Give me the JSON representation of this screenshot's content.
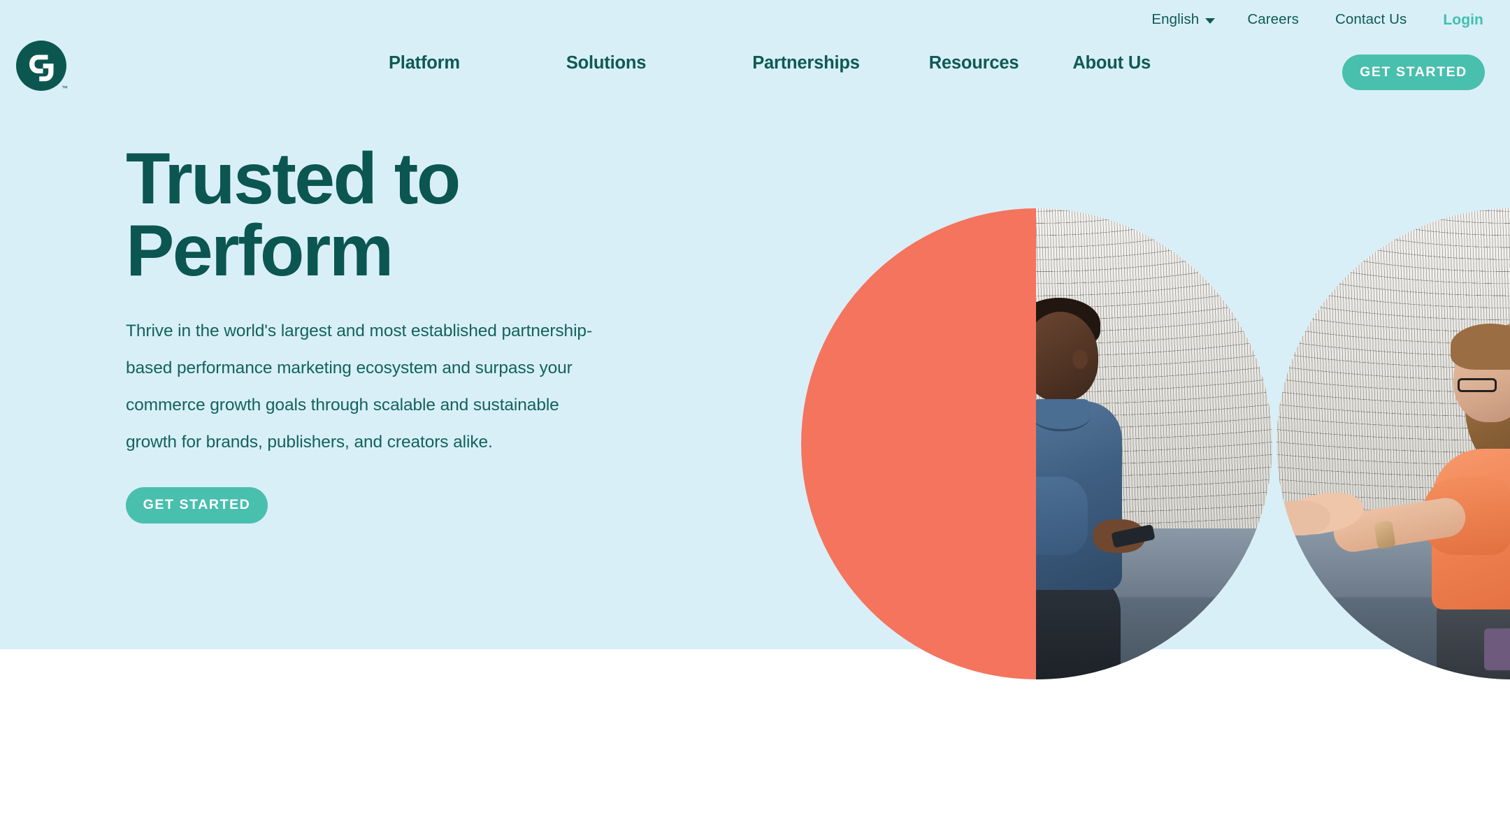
{
  "brand": {
    "logo_name": "cj-logo",
    "logo_tm": "™",
    "colors": {
      "hero_background": "#d9eff8",
      "dark_teal": "#0b5650",
      "mint_accent": "#49bfae",
      "login_teal": "#3fc0ad",
      "coral": "#f4745e",
      "page_background": "#ffffff"
    }
  },
  "utility_bar": {
    "language": "English",
    "careers": "Careers",
    "contact": "Contact Us",
    "login": "Login"
  },
  "nav": {
    "items": [
      {
        "label": "Platform"
      },
      {
        "label": "Solutions"
      },
      {
        "label": "Partnerships"
      },
      {
        "label": "Resources"
      },
      {
        "label": "About Us"
      }
    ],
    "cta_label": "GET STARTED"
  },
  "hero": {
    "title_line_1": "Trusted to",
    "title_line_2": "Perform",
    "paragraph": "Thrive in the world's largest and most established partnership-based performance marketing ecosystem and surpass your commerce growth goals through scalable and sustainable growth for brands, publishers, and creators alike.",
    "cta_label": "GET STARTED",
    "art": {
      "circle_left_alt": "Half coral circle beside photo of a man in a denim shirt seated on a sofa holding a phone",
      "circle_right_alt": "Circular photo of a woman in an orange top wearing glasses gesturing while seated on a sofa"
    }
  }
}
